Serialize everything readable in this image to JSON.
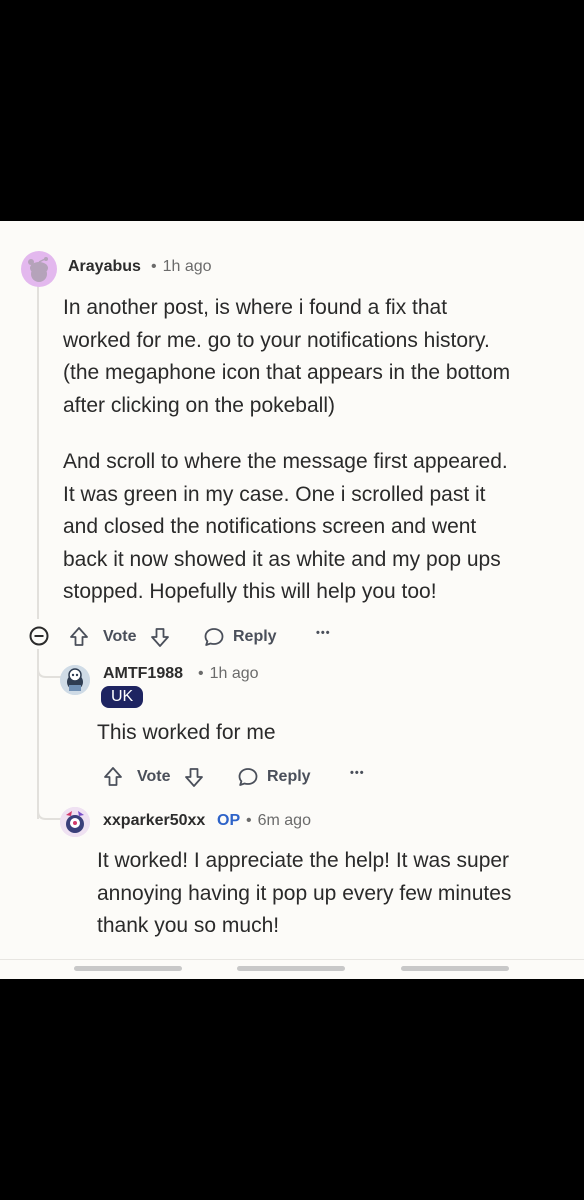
{
  "comment_main": {
    "username": "Arayabus",
    "time": "1h ago",
    "paragraph1_lines": [
      "In another post, is where i found a fix that",
      "worked for me. go to your notifications history.",
      "(the megaphone icon that appears in the bottom",
      "after clicking on the pokeball)"
    ],
    "paragraph2_lines": [
      "And scroll to where the message first appeared.",
      "It was green in my case. One i scrolled past it",
      "and closed the notifications screen and went",
      "back it now showed it as white and my pop ups",
      "stopped. Hopefully this will help you too!"
    ],
    "vote_label": "Vote",
    "reply_label": "Reply",
    "more_label": "•••"
  },
  "reply1": {
    "username": "AMTF1988",
    "time": "1h ago",
    "flair": "UK",
    "text": "This worked for me",
    "vote_label": "Vote",
    "reply_label": "Reply",
    "more_label": "•••"
  },
  "reply2": {
    "username": "xxparker50xx",
    "op_badge": "OP",
    "time": "6m ago",
    "lines": [
      "It worked! I appreciate the help! It was super",
      "annoying having it pop up every few minutes",
      "thank you so much!"
    ]
  },
  "colors": {
    "background": "#fcfbf8",
    "avatar_main": "#e3b8ee",
    "op_badge": "#2e63c8",
    "flair_bg": "#1e2461"
  }
}
